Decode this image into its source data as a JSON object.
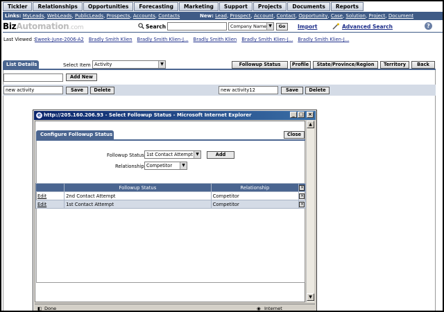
{
  "topnav": [
    "Tickler",
    "Relationships",
    "Opportunities",
    "Forecasting",
    "Marketing",
    "Support",
    "Projects",
    "Documents",
    "Reports"
  ],
  "links_bar": {
    "links_label": "Links:",
    "links": [
      "MyLeads",
      "WebLeads",
      "PublicLeads",
      "Prospects",
      "Accounts",
      "Contacts"
    ],
    "new_label": "New:",
    "new_links": [
      "Lead",
      "Prospect",
      "Account",
      "Contact",
      "Opportunity",
      "Case",
      "Solution",
      "Project",
      "Document"
    ]
  },
  "logo": {
    "part1": "Biz",
    "part2": "Automation",
    "part3": ".com"
  },
  "search": {
    "label": "Search",
    "value": "",
    "scope": "Company Name",
    "go": "Go"
  },
  "import_label": "Import",
  "advanced_search_label": "Advanced Search",
  "help_icon": "?",
  "last_viewed": {
    "label": "Last Viewed :",
    "items": [
      "Eweek-June-2006-A2",
      "Bradly Smith Klien",
      "Bradly Smith Klien-J...",
      "Bradly Smith Klien",
      "Bradly Smith Klien-J...",
      "Bradly Smith Klien-J..."
    ]
  },
  "list_details_tab": "List Details",
  "select_item": {
    "label": "Select Item",
    "value": "Activity"
  },
  "right_tabs": [
    "Followup Status",
    "Profile",
    "State/Province/Region",
    "Territory",
    "Back"
  ],
  "add_new": {
    "value": "",
    "button": "Add New"
  },
  "activities": [
    {
      "value": "new activity",
      "save": "Save",
      "delete": "Delete"
    },
    {
      "value": "new activity12",
      "save": "Save",
      "delete": "Delete"
    }
  ],
  "popup": {
    "title": "http://205.160.206.93 - Select Followup Status - Microsoft Internet Explorer",
    "tab": "Configure Followup Status",
    "close": "Close",
    "followup_label": "Followup Status",
    "followup_value": "1st Contact Attempt",
    "relationship_label": "Relationship",
    "relationship_value": "Competitor",
    "add": "Add",
    "table": {
      "headers": [
        "Followup Status",
        "Relationship"
      ],
      "rows": [
        {
          "edit": "Edit",
          "status": "2nd Contact Attempt",
          "relationship": "Competitor"
        },
        {
          "edit": "Edit",
          "status": "1st Contact Attempt",
          "relationship": "Competitor"
        }
      ]
    },
    "status_left": "Done",
    "status_right": "Internet"
  }
}
